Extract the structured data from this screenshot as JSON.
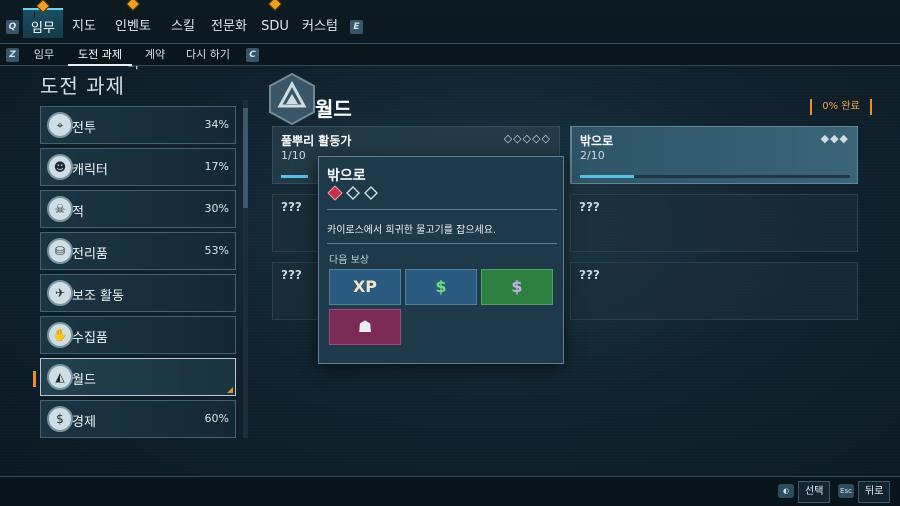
{
  "topnav": {
    "left_key": "Q",
    "right_key": "E",
    "tabs": [
      {
        "label": "임무",
        "active": true,
        "alert": true
      },
      {
        "label": "지도",
        "active": false,
        "alert": false
      },
      {
        "label": "인벤토리",
        "active": false,
        "alert": true
      },
      {
        "label": "스킬",
        "active": false,
        "alert": false
      },
      {
        "label": "전문화",
        "active": false,
        "alert": false
      },
      {
        "label": "SDU",
        "active": false,
        "alert": true
      },
      {
        "label": "커스텀",
        "active": false,
        "alert": false
      }
    ]
  },
  "subnav": {
    "left_key": "Z",
    "right_key": "C",
    "tabs": [
      {
        "label": "임무",
        "active": false
      },
      {
        "label": "도전 과제",
        "active": true
      },
      {
        "label": "계약",
        "active": false
      },
      {
        "label": "다시 하기",
        "active": false
      }
    ]
  },
  "page_title": "도전 과제",
  "categories": [
    {
      "label": "전투",
      "percent": "34%",
      "icon": "⌖"
    },
    {
      "label": "캐릭터",
      "percent": "17%",
      "icon": "☻"
    },
    {
      "label": "적",
      "percent": "30%",
      "icon": "☠"
    },
    {
      "label": "전리품",
      "percent": "53%",
      "icon": "⛁"
    },
    {
      "label": "보조 활동",
      "percent": "",
      "icon": "✈"
    },
    {
      "label": "수집품",
      "percent": "",
      "icon": "✋"
    },
    {
      "label": "월드",
      "percent": "",
      "icon": "◭",
      "selected": true
    },
    {
      "label": "경제",
      "percent": "60%",
      "icon": "$"
    }
  ],
  "world": {
    "title": "월드",
    "progress": "0% 완료"
  },
  "cards": {
    "c1": {
      "title": "풀뿌리 활동가",
      "count": "1/10",
      "diamonds": "◇◇◇◇◇",
      "progress": 0.1
    },
    "c2": {
      "title": "밖으로",
      "count": "2/10",
      "diamonds": "◆◆◆",
      "progress": 0.2
    },
    "locked_label": "???"
  },
  "tooltip": {
    "title": "밖으로",
    "description": "카이로스에서 희귀한 물고기를 잡으세요.",
    "reward_label": "다음 보상",
    "rewards": [
      {
        "name": "xp",
        "glyph": "XP",
        "color": "#2a5a80"
      },
      {
        "name": "currency",
        "glyph": "$",
        "color": "#2a5a80"
      },
      {
        "name": "credit",
        "glyph": "$",
        "color": "#2e8040"
      },
      {
        "name": "cosmetic",
        "glyph": "☗",
        "color": "#7a2a55"
      }
    ]
  },
  "bottom": {
    "select_label": "선택",
    "back_label": "뒤로",
    "select_key": "◐",
    "back_key": "Esc"
  },
  "colors": {
    "accent": "#f08c20",
    "highlight": "#58c0e8"
  }
}
